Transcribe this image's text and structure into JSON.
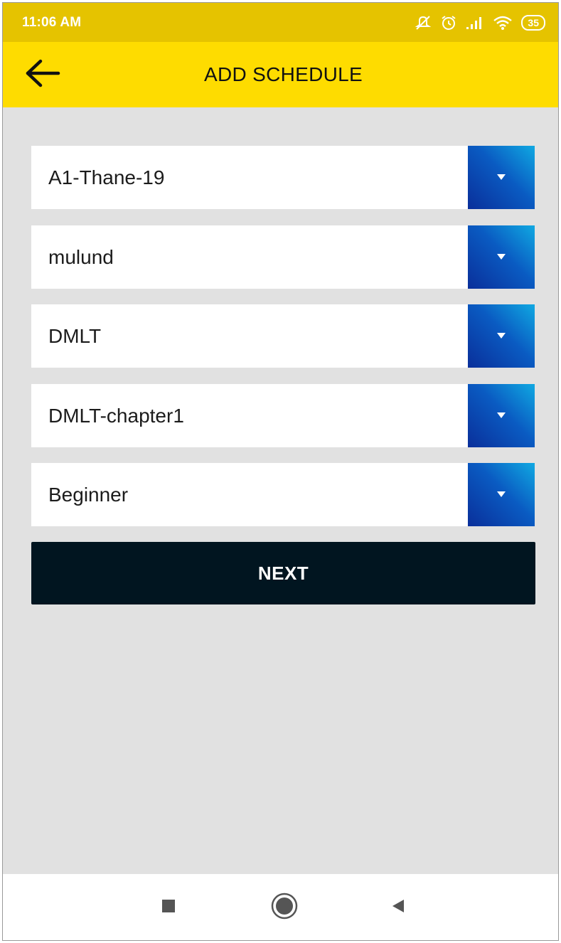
{
  "status_bar": {
    "time": "11:06 AM",
    "battery": "35",
    "icons": [
      "mute-icon",
      "alarm-icon",
      "signal-icon",
      "wifi-icon",
      "battery-icon"
    ]
  },
  "app_bar": {
    "title": "ADD SCHEDULE",
    "back_icon": "arrow-left-icon",
    "color": "#fedc00"
  },
  "form": {
    "dropdowns": [
      {
        "value": "A1-Thane-19"
      },
      {
        "value": "mulund"
      },
      {
        "value": "DMLT"
      },
      {
        "value": "DMLT-chapter1"
      },
      {
        "value": "Beginner"
      }
    ],
    "next_label": "NEXT"
  },
  "nav_bar": {
    "icons": [
      "recents-square-icon",
      "home-circle-icon",
      "back-triangle-icon"
    ]
  },
  "colors": {
    "accent": "#fedc00",
    "status": "#e5c300",
    "button": "#011520",
    "arrow_gradient": [
      "#10a9e2",
      "#0a2f9a"
    ],
    "background": "#e1e1e1"
  }
}
